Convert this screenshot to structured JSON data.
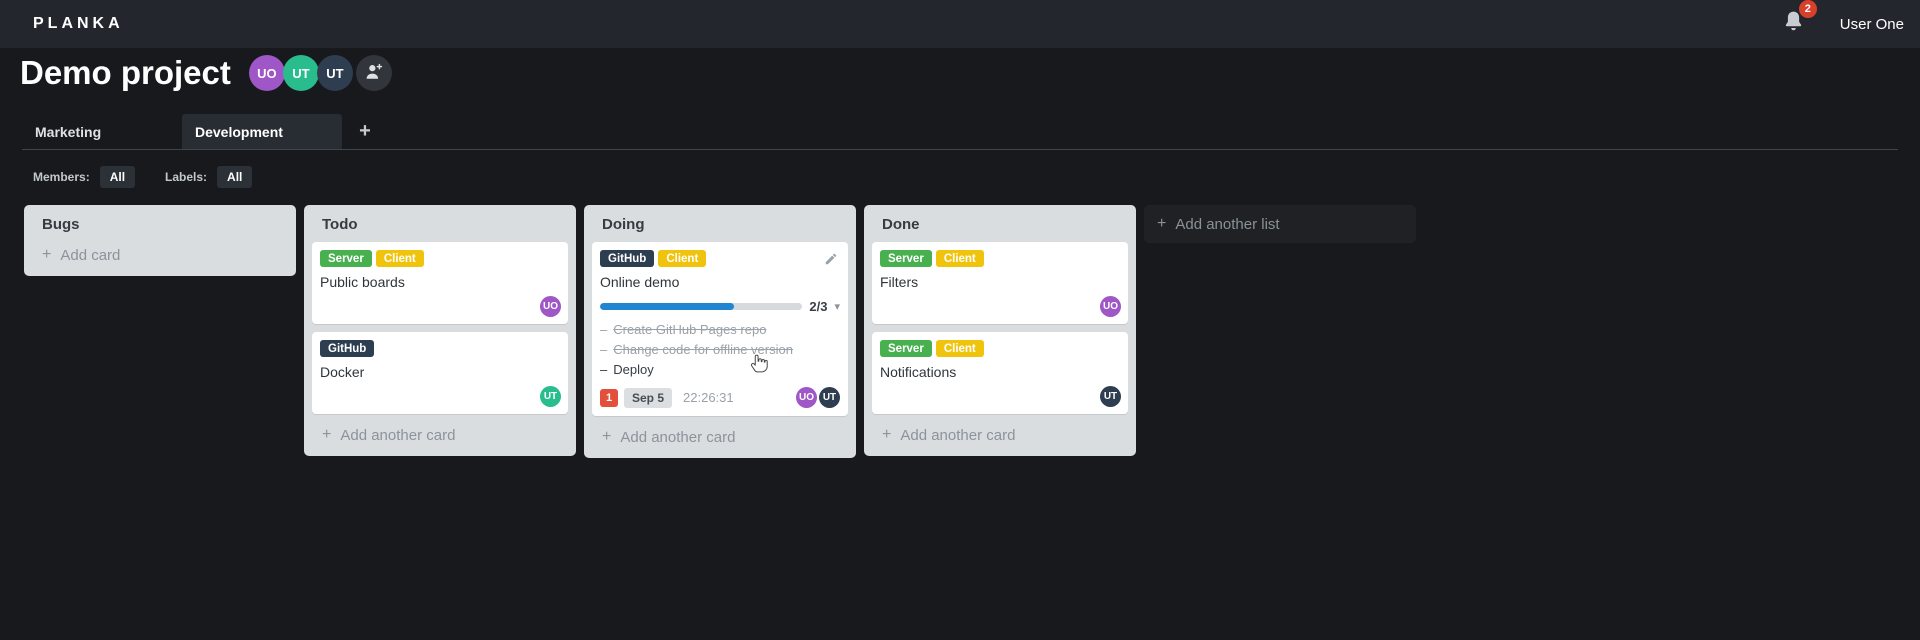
{
  "icons": {
    "plus": "+",
    "caret_down": "▾",
    "dash": "–"
  },
  "colors": {
    "header_bg": "#23272d",
    "page_bg": "#17191d",
    "list_bg": "#dadde0",
    "label_green": "#49b04f",
    "label_yellow": "#f0c30c",
    "label_dark_blue": "#2c3e50",
    "avatar_purple": "#9f56c6",
    "avatar_teal": "#29bd8d",
    "avatar_dark": "#2e3d4f",
    "progress_blue": "#2185d0",
    "due_badge_red": "#e2503c",
    "notification_badge_red": "#d8402c"
  },
  "header": {
    "logo": "PLANKA",
    "notification_count": "2",
    "user_name": "User One"
  },
  "project": {
    "title": "Demo project",
    "members": [
      {
        "initials": "UO"
      },
      {
        "initials": "UT"
      },
      {
        "initials": "UT"
      }
    ]
  },
  "tabs": {
    "items": [
      {
        "label": "Marketing"
      },
      {
        "label": "Development"
      }
    ]
  },
  "filters": {
    "members_label": "Members:",
    "members_value": "All",
    "labels_label": "Labels:",
    "labels_value": "All"
  },
  "board": {
    "add_list_label": "Add another list",
    "lists": [
      {
        "title": "Bugs",
        "add_card_label": "Add card",
        "cards": []
      },
      {
        "title": "Todo",
        "add_card_label": "Add another card",
        "cards": [
          {
            "title": "Public boards",
            "labels": [
              "Server",
              "Client"
            ],
            "members": [
              "UO"
            ]
          },
          {
            "title": "Docker",
            "labels": [
              "GitHub"
            ],
            "members": [
              "UT"
            ]
          }
        ]
      },
      {
        "title": "Doing",
        "add_card_label": "Add another card",
        "cards": [
          {
            "title": "Online demo",
            "labels": [
              "GitHub",
              "Client"
            ],
            "progress_label": "2/3",
            "tasks": [
              {
                "text": "Create GitHub Pages repo",
                "done": true
              },
              {
                "text": "Change code for offline version",
                "done": true
              },
              {
                "text": "Deploy",
                "done": false
              }
            ],
            "due_soon_count": "1",
            "due_date": "Sep 5",
            "stopwatch": "22:26:31",
            "members": [
              "UO",
              "UT"
            ]
          }
        ]
      },
      {
        "title": "Done",
        "add_card_label": "Add another card",
        "cards": [
          {
            "title": "Filters",
            "labels": [
              "Server",
              "Client"
            ],
            "members": [
              "UO"
            ]
          },
          {
            "title": "Notifications",
            "labels": [
              "Server",
              "Client"
            ],
            "members": [
              "UT"
            ]
          }
        ]
      }
    ]
  }
}
